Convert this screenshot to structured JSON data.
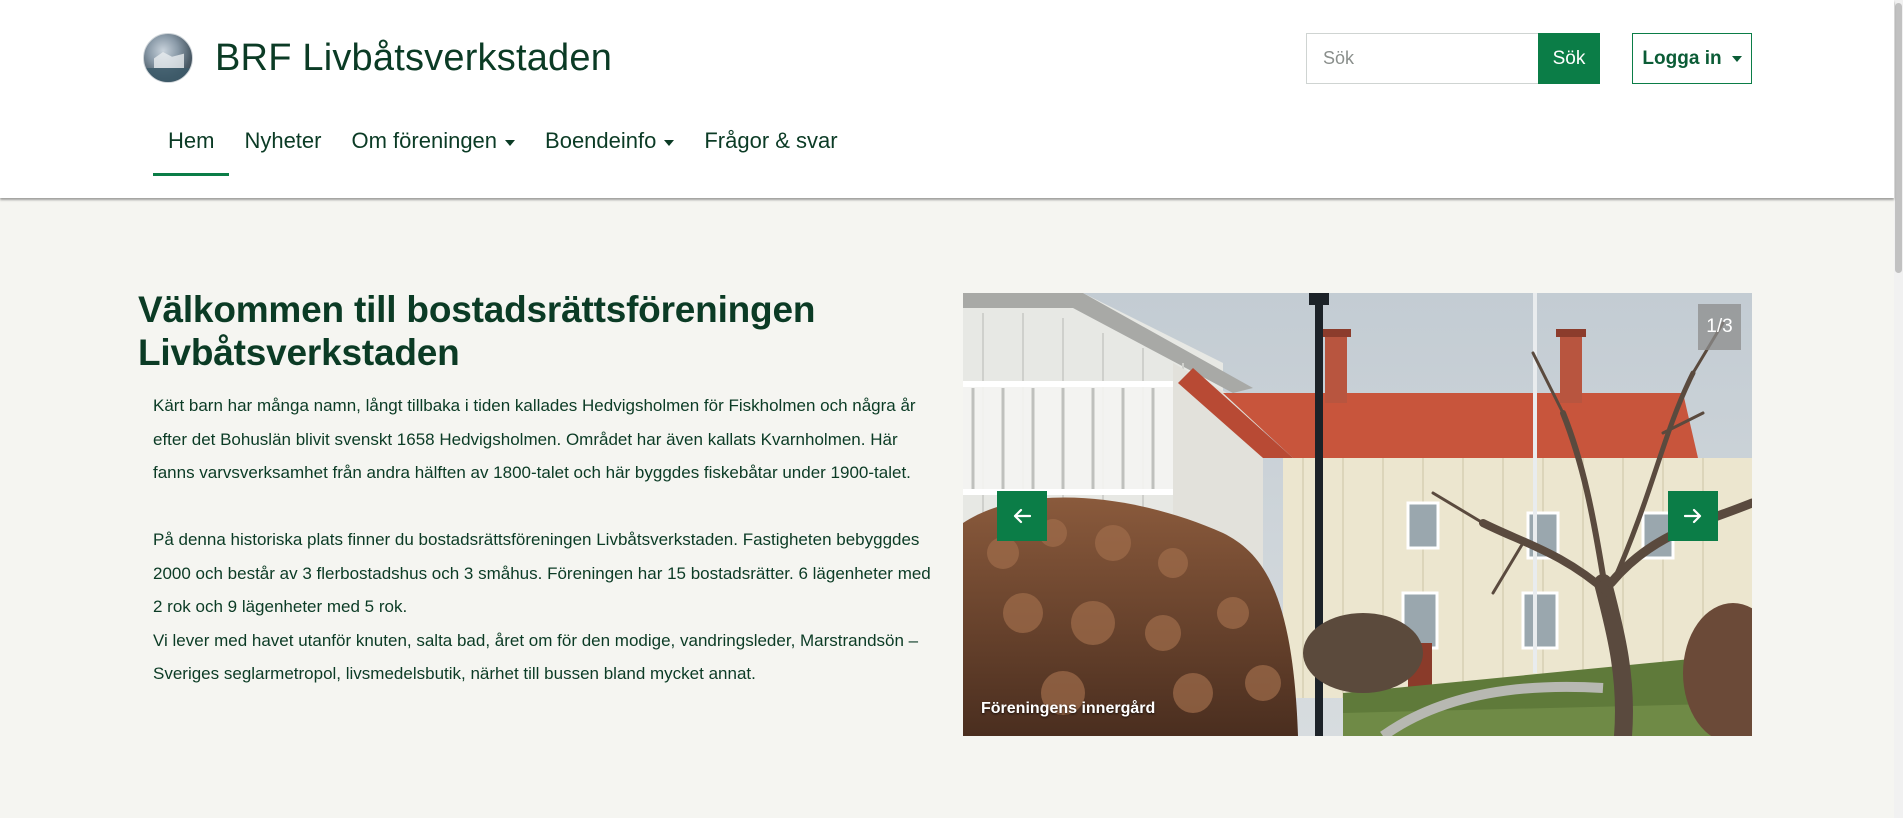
{
  "site": {
    "title": "BRF Livbåtsverkstaden"
  },
  "search": {
    "placeholder": "Sök",
    "button_label": "Sök"
  },
  "login": {
    "label": "Logga in"
  },
  "nav": {
    "items": [
      {
        "label": "Hem",
        "active": true,
        "dropdown": false
      },
      {
        "label": "Nyheter",
        "active": false,
        "dropdown": false
      },
      {
        "label": "Om föreningen",
        "active": false,
        "dropdown": true
      },
      {
        "label": "Boendeinfo",
        "active": false,
        "dropdown": true
      },
      {
        "label": "Frågor & svar",
        "active": false,
        "dropdown": false
      }
    ]
  },
  "main": {
    "title": "Välkommen till bostadsrättsföreningen Livbåtsverkstaden",
    "paragraph1": "Kärt barn har många namn, långt tillbaka i tiden kallades Hedvigsholmen för Fiskholmen och några år efter det Bohuslän blivit svenskt 1658 Hedvigsholmen. Området har även kallats Kvarnholmen. Här fanns varvsverksamhet från andra hälften av 1800-talet och här byggdes fiskebåtar under 1900-talet.",
    "paragraph2": "På denna historiska plats finner du bostadsrättsföreningen Livbåtsverkstaden. Fastigheten bebyggdes 2000 och består av 3 flerbostadshus och 3 småhus. Föreningen har 15 bostadsrätter. 6 lägenheter med 2 rok och 9 lägenheter med 5 rok.",
    "paragraph3": "Vi lever med havet utanför knuten, salta bad, året om för den modige, vandringsleder, Marstrandsön – Sveriges seglarmetropol, livsmedelsbutik, närhet till bussen bland mycket annat."
  },
  "carousel": {
    "counter": "1/3",
    "caption": "Föreningens innergård",
    "prev_icon": "arrow-left-icon",
    "next_icon": "arrow-right-icon"
  },
  "colors": {
    "brand_green": "#0b7d47",
    "text_dark_green": "#0b3b25",
    "page_background": "#f5f5f1"
  }
}
